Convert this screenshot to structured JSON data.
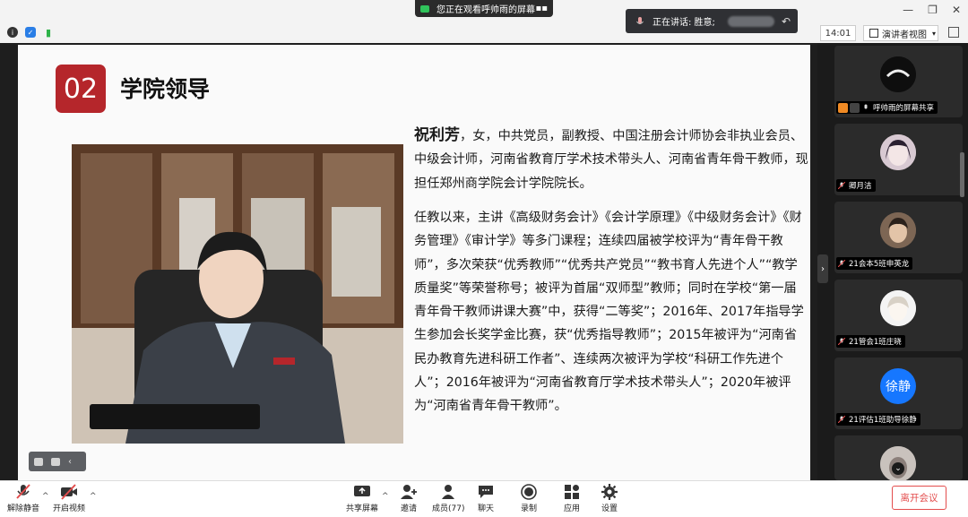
{
  "window": {
    "share_banner": "您正在观看呼帅雨的屏幕",
    "share_menu": "▪▪",
    "speaking_prefix": "正在讲话: 胜意;",
    "time": "14:01",
    "view_mode": "演讲者视图"
  },
  "slide": {
    "number": "02",
    "title": "学院领导",
    "person_name": "祝利芳",
    "p1_rest": "，女，中共党员，副教授、中国注册会计师协会非执业会员、中级会计师，河南省教育厅学术技术带头人、河南省青年骨干教师，现担任郑州商学院会计学院院长。",
    "p2": "任教以来，主讲《高级财务会计》《会计学原理》《中级财务会计》《财务管理》《审计学》等多门课程；连续四届被学校评为“青年骨干教师”，多次荣获“优秀教师”“优秀共产党员”“教书育人先进个人”“教学质量奖”等荣誉称号；被评为首届“双师型”教师；同时在学校“第一届青年骨干教师讲课大赛”中，获得“二等奖”；2016年、2017年指导学生参加会长奖学金比赛，获“优秀指导教师”；2015年被评为“河南省民办教育先进科研工作者”、连续两次被评为学校“科研工作先进个人”；2016年被评为“河南省教育厅学术技术带头人”；2020年被评为“河南省青年骨干教师”。"
  },
  "participants": [
    {
      "name": "呼帅雨的屏幕共享",
      "avatar_text": "",
      "top": 0
    },
    {
      "name": "卿月洁",
      "avatar_text": ""
    },
    {
      "name": "21会本5班申英龙",
      "avatar_text": ""
    },
    {
      "name": "21管会1班庄晓",
      "avatar_text": ""
    },
    {
      "name": "21评估1班助导徐静",
      "avatar_text": "徐静"
    }
  ],
  "toolbar": {
    "unmute": "解除静音",
    "start_video": "开启视频",
    "share_screen": "共享屏幕",
    "invite": "邀请",
    "members": "成员(77)",
    "chat": "聊天",
    "record": "录制",
    "apps": "应用",
    "settings": "设置",
    "leave": "离开会议"
  },
  "colors": {
    "accent_red": "#b5262b",
    "leave_red": "#e34d4d",
    "avatar_blue": "#1677ff"
  }
}
